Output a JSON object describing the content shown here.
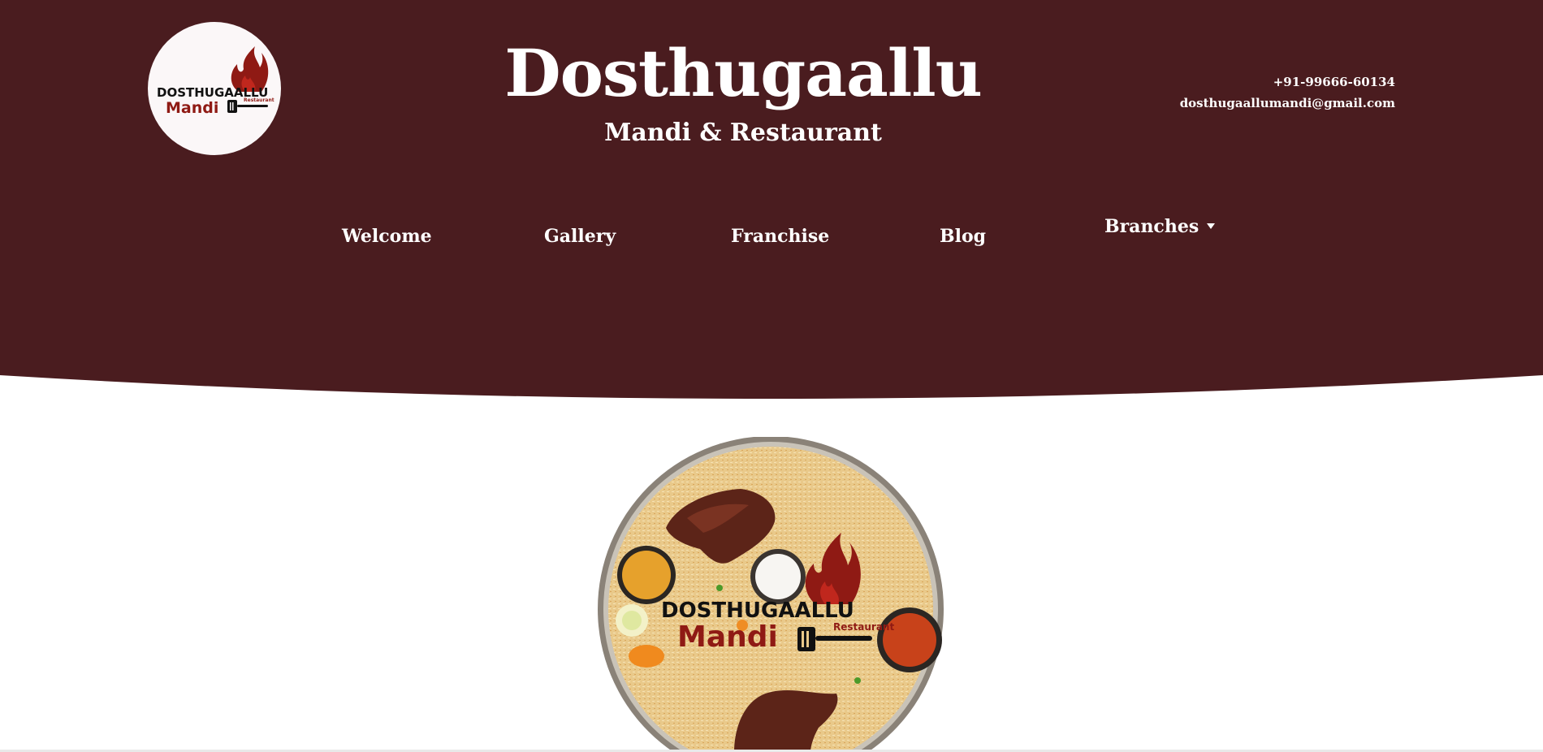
{
  "colors": {
    "header_bg": "#4a1c1f",
    "text": "#ffffff",
    "brand_red": "#8f1a14",
    "page_bg": "#ffffff"
  },
  "logo": {
    "brand_line1": "DOSTHUGAALLU",
    "brand_line2": "Mandi",
    "brand_tag": "Restaurant",
    "icon": "flame-spatula-logo"
  },
  "header": {
    "title": "Dosthugaallu",
    "subtitle": "Mandi & Restaurant"
  },
  "contact": {
    "phone": "+91-99666-60134",
    "email": "dosthugaallumandi@gmail.com"
  },
  "nav": {
    "items": [
      {
        "label": "Welcome"
      },
      {
        "label": "Gallery"
      },
      {
        "label": "Franchise"
      },
      {
        "label": "Blog"
      },
      {
        "label": "Branches",
        "has_dropdown": true
      }
    ]
  },
  "hero": {
    "image": "mandi-platter",
    "brand_line1": "DOSTHUGAALLU",
    "brand_line2": "Mandi",
    "brand_tag": "Restaurant"
  }
}
